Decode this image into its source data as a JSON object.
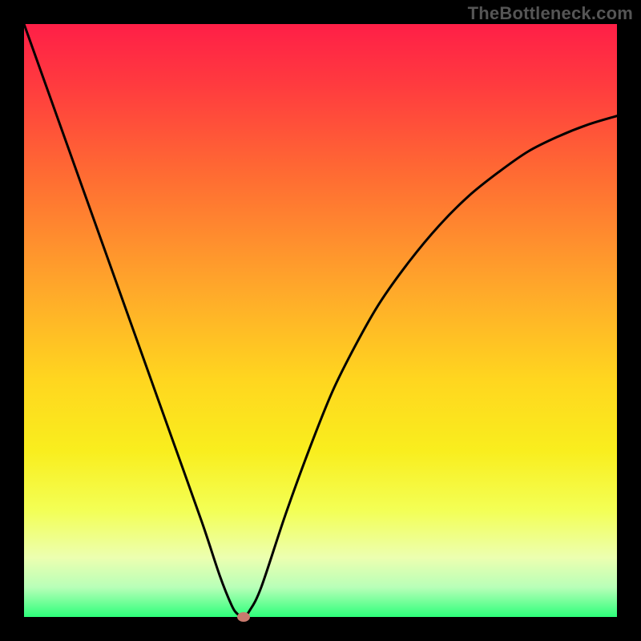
{
  "watermark": "TheBottleneck.com",
  "colors": {
    "background": "#000000",
    "gradient_stops": [
      {
        "pos": 0,
        "color": "#ff1f47"
      },
      {
        "pos": 0.1,
        "color": "#ff3a3f"
      },
      {
        "pos": 0.25,
        "color": "#ff6a33"
      },
      {
        "pos": 0.45,
        "color": "#ffa92a"
      },
      {
        "pos": 0.6,
        "color": "#ffd61f"
      },
      {
        "pos": 0.72,
        "color": "#f9ee1e"
      },
      {
        "pos": 0.82,
        "color": "#f3ff55"
      },
      {
        "pos": 0.9,
        "color": "#ecffb0"
      },
      {
        "pos": 0.95,
        "color": "#b8ffb8"
      },
      {
        "pos": 1.0,
        "color": "#2dff7a"
      }
    ],
    "curve": "#000000",
    "dot": "#c97a6e"
  },
  "chart_data": {
    "type": "line",
    "title": "",
    "xlabel": "",
    "ylabel": "",
    "xlim": [
      0,
      100
    ],
    "ylim": [
      0,
      100
    ],
    "annotations": [
      "TheBottleneck.com"
    ],
    "x": [
      0,
      5,
      10,
      15,
      20,
      25,
      30,
      33,
      35,
      36,
      37,
      38,
      40,
      44,
      48,
      52,
      56,
      60,
      65,
      70,
      75,
      80,
      85,
      90,
      95,
      100
    ],
    "values": [
      100,
      86,
      72,
      58,
      44,
      30,
      16,
      7,
      2,
      0.5,
      0,
      1,
      5,
      17,
      28,
      38,
      46,
      53,
      60,
      66,
      71,
      75,
      78.5,
      81,
      83,
      84.5
    ],
    "marker": {
      "x": 37,
      "y": 0
    }
  }
}
